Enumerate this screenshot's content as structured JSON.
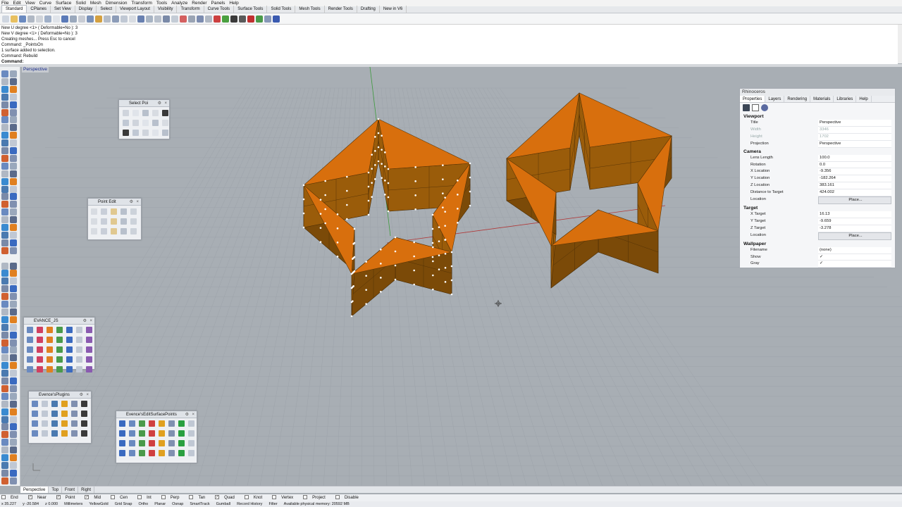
{
  "menu": [
    "File",
    "Edit",
    "View",
    "Curve",
    "Surface",
    "Solid",
    "Mesh",
    "Dimension",
    "Transform",
    "Tools",
    "Analyze",
    "Render",
    "Panels",
    "Help"
  ],
  "tabs": [
    "Standard",
    "CPlanes",
    "Set View",
    "Display",
    "Select",
    "Viewport Layout",
    "Visibility",
    "Transform",
    "Curve Tools",
    "Surface Tools",
    "Solid Tools",
    "Mesh Tools",
    "Render Tools",
    "Drafting",
    "New in V6"
  ],
  "command_history": [
    "New U degree <1> ( Deformable=No ): 3",
    "New V degree <1> ( Deformable=No ): 3",
    "Creating meshes... Press Esc to cancel",
    "Command: _PointsOn",
    "1 surface added to selection.",
    "Command: Rebuild"
  ],
  "command_prompt": "Command:",
  "viewport_label": "Perspective",
  "panels": {
    "select_points": "Select Poi",
    "point_edit": "Point Edit",
    "evance_js": "EVANCE_JS",
    "evance_plugins": "Evence'sPlugins",
    "evance_edit": "Evence'sEditSurfacePoints"
  },
  "properties": {
    "window_title": "Rhinoceros",
    "tabs": [
      "Properties",
      "Layers",
      "Rendering",
      "Materials",
      "Libraries",
      "Help"
    ],
    "sections": [
      {
        "title": "Viewport",
        "rows": [
          {
            "k": "Title",
            "v": "Perspective"
          },
          {
            "k": "Width",
            "v": "3346",
            "disabled": true
          },
          {
            "k": "Height",
            "v": "1702",
            "disabled": true
          },
          {
            "k": "Projection",
            "v": "Perspective"
          }
        ]
      },
      {
        "title": "Camera",
        "rows": [
          {
            "k": "Lens Length",
            "v": "100.0"
          },
          {
            "k": "Rotation",
            "v": "0.0"
          },
          {
            "k": "X Location",
            "v": "-9.356"
          },
          {
            "k": "Y Location",
            "v": "-182.264"
          },
          {
            "k": "Z Location",
            "v": "383.161"
          },
          {
            "k": "Distance to Target",
            "v": "424.002"
          },
          {
            "k": "Location",
            "v": "Place...",
            "button": true
          }
        ]
      },
      {
        "title": "Target",
        "rows": [
          {
            "k": "X Target",
            "v": "16.13"
          },
          {
            "k": "Y Target",
            "v": "-9.659"
          },
          {
            "k": "Z Target",
            "v": "-3.278"
          },
          {
            "k": "Location",
            "v": "Place...",
            "button": true
          }
        ]
      },
      {
        "title": "Wallpaper",
        "rows": [
          {
            "k": "Filename",
            "v": "(none)"
          },
          {
            "k": "Show",
            "v": "✓"
          },
          {
            "k": "Gray",
            "v": "✓"
          }
        ]
      }
    ]
  },
  "viewport_tabs": [
    "Perspective",
    "Top",
    "Front",
    "Right"
  ],
  "osnaps": [
    {
      "label": "End",
      "checked": false
    },
    {
      "label": "Near",
      "checked": true
    },
    {
      "label": "Point",
      "checked": true
    },
    {
      "label": "Mid",
      "checked": true
    },
    {
      "label": "Cen",
      "checked": false
    },
    {
      "label": "Int",
      "checked": false
    },
    {
      "label": "Perp",
      "checked": false
    },
    {
      "label": "Tan",
      "checked": false
    },
    {
      "label": "Quad",
      "checked": true
    },
    {
      "label": "Knot",
      "checked": false
    },
    {
      "label": "Vertex",
      "checked": false
    },
    {
      "label": "Project",
      "checked": false
    },
    {
      "label": "Disable",
      "checked": false
    }
  ],
  "status_bar": [
    "x 35.227",
    "y -20.584",
    "z 0.000",
    "Millimeters",
    "YellowGold",
    "Grid Snap",
    "Ortho",
    "Planar",
    "Osnap",
    "SmartTrack",
    "Gumball",
    "Record History",
    "Filter",
    "Available physical memory: 20592 MB"
  ],
  "colors": {
    "surface": "#d86f0d",
    "surface_dark": "#7b4a08",
    "surface_mid": "#9a5c0a",
    "accent": "#1a2c8c"
  }
}
